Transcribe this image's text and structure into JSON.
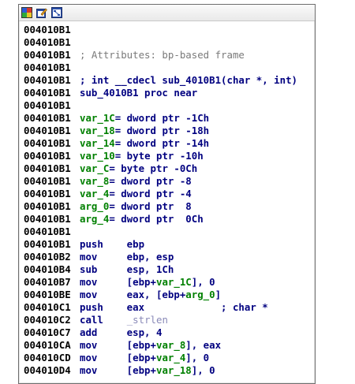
{
  "toolbar": {
    "icons": [
      "color-palette-icon",
      "edit-graph-icon",
      "view-graph-icon"
    ]
  },
  "lines": [
    {
      "addr": "004010B1",
      "parts": []
    },
    {
      "addr": "004010B1",
      "parts": []
    },
    {
      "addr": "004010B1",
      "parts": [
        {
          "cls": "comment",
          "text": "; Attributes: bp-based frame"
        }
      ]
    },
    {
      "addr": "004010B1",
      "parts": []
    },
    {
      "addr": "004010B1",
      "parts": [
        {
          "cls": "code",
          "text": "; int __cdecl sub_4010B1(char *, int)"
        }
      ]
    },
    {
      "addr": "004010B1",
      "parts": [
        {
          "cls": "code",
          "text": "sub_4010B1 proc near"
        }
      ]
    },
    {
      "addr": "004010B1",
      "parts": []
    },
    {
      "addr": "004010B1",
      "parts": [
        {
          "cls": "var",
          "text": "var_1C"
        },
        {
          "cls": "code",
          "text": "= dword ptr -1Ch"
        }
      ]
    },
    {
      "addr": "004010B1",
      "parts": [
        {
          "cls": "var",
          "text": "var_18"
        },
        {
          "cls": "code",
          "text": "= dword ptr -18h"
        }
      ]
    },
    {
      "addr": "004010B1",
      "parts": [
        {
          "cls": "var",
          "text": "var_14"
        },
        {
          "cls": "code",
          "text": "= dword ptr -14h"
        }
      ]
    },
    {
      "addr": "004010B1",
      "parts": [
        {
          "cls": "var",
          "text": "var_10"
        },
        {
          "cls": "code",
          "text": "= byte ptr -10h"
        }
      ]
    },
    {
      "addr": "004010B1",
      "parts": [
        {
          "cls": "var",
          "text": "var_C"
        },
        {
          "cls": "code",
          "text": "= byte ptr -0Ch"
        }
      ]
    },
    {
      "addr": "004010B1",
      "parts": [
        {
          "cls": "var",
          "text": "var_8"
        },
        {
          "cls": "code",
          "text": "= dword ptr -8"
        }
      ]
    },
    {
      "addr": "004010B1",
      "parts": [
        {
          "cls": "var",
          "text": "var_4"
        },
        {
          "cls": "code",
          "text": "= dword ptr -4"
        }
      ]
    },
    {
      "addr": "004010B1",
      "parts": [
        {
          "cls": "var",
          "text": "arg_0"
        },
        {
          "cls": "code",
          "text": "= dword ptr  8"
        }
      ]
    },
    {
      "addr": "004010B1",
      "parts": [
        {
          "cls": "var",
          "text": "arg_4"
        },
        {
          "cls": "code",
          "text": "= dword ptr  0Ch"
        }
      ]
    },
    {
      "addr": "004010B1",
      "parts": []
    },
    {
      "addr": "004010B1",
      "parts": [
        {
          "cls": "code",
          "text": "push    ebp"
        }
      ]
    },
    {
      "addr": "004010B2",
      "parts": [
        {
          "cls": "code",
          "text": "mov     ebp, esp"
        }
      ]
    },
    {
      "addr": "004010B4",
      "parts": [
        {
          "cls": "code",
          "text": "sub     esp, 1Ch"
        }
      ]
    },
    {
      "addr": "004010B7",
      "parts": [
        {
          "cls": "code",
          "text": "mov     [ebp+"
        },
        {
          "cls": "var",
          "text": "var_1C"
        },
        {
          "cls": "code",
          "text": "], 0"
        }
      ]
    },
    {
      "addr": "004010BE",
      "parts": [
        {
          "cls": "code",
          "text": "mov     eax, [ebp+"
        },
        {
          "cls": "var",
          "text": "arg_0"
        },
        {
          "cls": "code",
          "text": "]"
        }
      ]
    },
    {
      "addr": "004010C1",
      "parts": [
        {
          "cls": "code",
          "text": "push    eax             ; char *"
        }
      ]
    },
    {
      "addr": "004010C2",
      "parts": [
        {
          "cls": "code",
          "text": "call    "
        },
        {
          "cls": "ext",
          "text": "_strlen"
        }
      ]
    },
    {
      "addr": "004010C7",
      "parts": [
        {
          "cls": "code",
          "text": "add     esp, 4"
        }
      ]
    },
    {
      "addr": "004010CA",
      "parts": [
        {
          "cls": "code",
          "text": "mov     [ebp+"
        },
        {
          "cls": "var",
          "text": "var_8"
        },
        {
          "cls": "code",
          "text": "], eax"
        }
      ]
    },
    {
      "addr": "004010CD",
      "parts": [
        {
          "cls": "code",
          "text": "mov     [ebp+"
        },
        {
          "cls": "var",
          "text": "var_4"
        },
        {
          "cls": "code",
          "text": "], 0"
        }
      ]
    },
    {
      "addr": "004010D4",
      "parts": [
        {
          "cls": "code",
          "text": "mov     [ebp+"
        },
        {
          "cls": "var",
          "text": "var_18"
        },
        {
          "cls": "code",
          "text": "], 0"
        }
      ]
    }
  ]
}
